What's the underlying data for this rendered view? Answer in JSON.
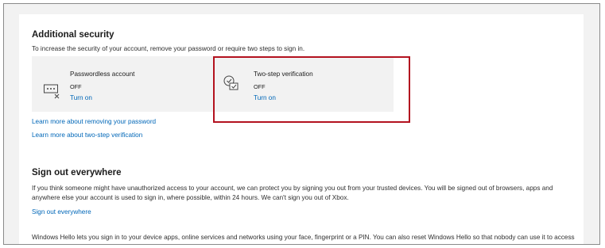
{
  "additional_security": {
    "title": "Additional security",
    "description": "To increase the security of your account, remove your password or require two steps to sign in.",
    "passwordless": {
      "title": "Passwordless account",
      "status": "OFF",
      "action": "Turn on"
    },
    "two_step": {
      "title": "Two-step verification",
      "status": "OFF",
      "action": "Turn on"
    },
    "learn_remove_password": "Learn more about removing your password",
    "learn_two_step": "Learn more about two-step verification"
  },
  "sign_out": {
    "title": "Sign out everywhere",
    "description": "If you think someone might have unauthorized access to your account, we can protect you by signing you out from your trusted devices. You will be signed out of browsers, apps and anywhere else your account is used to sign in, where possible, within 24 hours. We can't sign you out of Xbox.",
    "link": "Sign out everywhere"
  },
  "windows_hello": {
    "description": "Windows Hello lets you sign in to your device apps, online services and networks using your face, fingerprint or a PIN. You can also reset Windows Hello so that nobody can use it to access your Microsoft account services, including Xbox cloud services. You will still be able to unlock your devices."
  },
  "colors": {
    "link": "#0067b8",
    "highlight": "#b3121f",
    "background": "#f2f2f2"
  }
}
